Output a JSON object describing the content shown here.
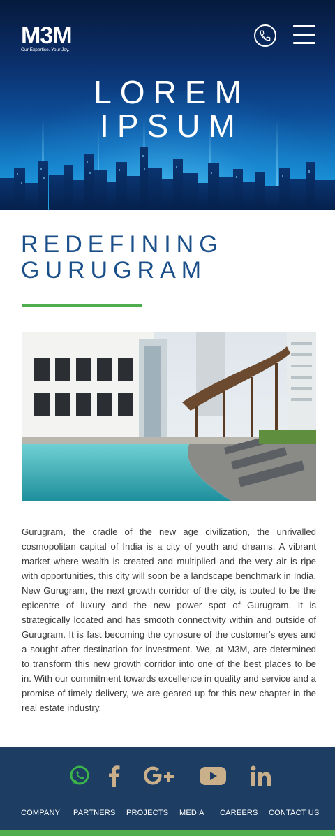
{
  "header": {
    "logo_text": "M3M",
    "logo_tagline": "Our Expertise. Your Joy.",
    "hero_title_line1": "LOREM",
    "hero_title_line2": "IPSUM"
  },
  "intro": {
    "title_line1": "REDEFINING",
    "title_line2": "GURUGRAM",
    "body": "Gurugram, the cradle of the new age civilization, the unrivalled cosmopolitan capital of India is a city of youth and dreams. A vibrant market where wealth is created and multiplied and the very air is ripe with opportunities, this city will soon be a landscape benchmark in India. New Gurugram, the next growth corridor of the city, is touted to be the epicentre of luxury and the new power spot of Gurugram. It is strategically located and has smooth connectivity within and outside of Gurugram. It is fast becoming the cynosure of the customer's eyes and a sought after destination for investment. We, at M3M, are determined to transform this new growth corridor into one of the best places to be in. With our commitment towards excellence in quality and service and a promise of timely delivery, we are geared up for this new chapter in the real estate industry."
  },
  "socials": [
    "whatsapp-icon",
    "facebook-icon",
    "google-plus-icon",
    "youtube-icon",
    "linkedin-icon"
  ],
  "footer_nav": {
    "company": "COMPANY",
    "partners": "PARTNERS",
    "projects": "PROJECTS",
    "media": "MEDIA",
    "careers": "CAREERS",
    "contact": "CONTACT US"
  },
  "colors": {
    "brand_blue": "#1b4f8a",
    "accent_green": "#4fad4d",
    "footer_bg": "#1d3d63",
    "social_gold": "#c9b08a",
    "whatsapp_green": "#3bb54a"
  }
}
